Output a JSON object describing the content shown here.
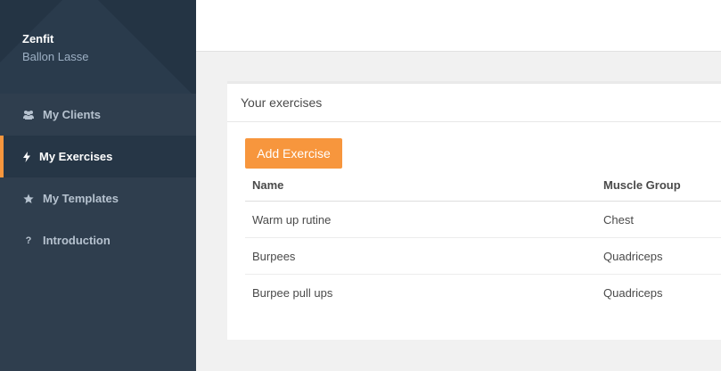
{
  "brand": {
    "name": "Zenfit",
    "user": "Ballon Lasse"
  },
  "nav": [
    {
      "label": "My Clients",
      "icon": "users-icon",
      "active": false
    },
    {
      "label": "My Exercises",
      "icon": "bolt-icon",
      "active": true
    },
    {
      "label": "My Templates",
      "icon": "star-icon",
      "active": false
    },
    {
      "label": "Introduction",
      "icon": "question-icon",
      "active": false
    }
  ],
  "panel": {
    "title": "Your exercises",
    "add_button": "Add Exercise",
    "columns": [
      "Name",
      "Muscle Group"
    ],
    "rows": [
      [
        "Warm up rutine",
        "Chest"
      ],
      [
        "Burpees",
        "Quadriceps"
      ],
      [
        "Burpee pull ups",
        "Quadriceps"
      ]
    ]
  },
  "colors": {
    "accent": "#f7963d",
    "sidebar": "#2f3e4e",
    "sidebar_dark": "#243444"
  }
}
